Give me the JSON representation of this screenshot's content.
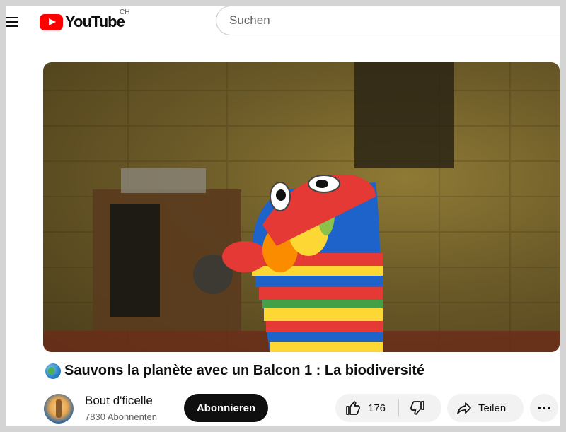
{
  "header": {
    "logo_text": "YouTube",
    "country_code": "CH",
    "search_placeholder": "Suchen"
  },
  "video": {
    "title": "Sauvons la planète avec un Balcon 1 : La biodiversité",
    "title_icon": "globe-icon"
  },
  "channel": {
    "name": "Bout d'ficelle",
    "subscribers": "7830 Abonnenten",
    "subscribe_label": "Abonnieren"
  },
  "actions": {
    "like_count": "176",
    "share_label": "Teilen"
  },
  "colors": {
    "brand_red": "#ff0000",
    "subscribe_bg": "#0f0f0f",
    "pill_bg": "#f2f2f2"
  }
}
